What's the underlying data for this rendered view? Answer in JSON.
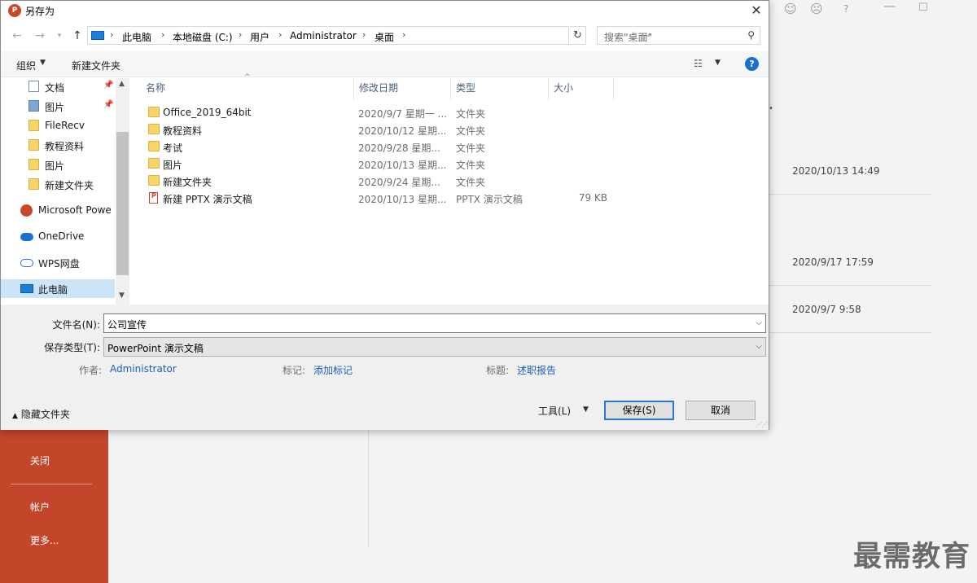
{
  "dialog": {
    "title": "另存为",
    "close": "✕"
  },
  "address": {
    "crumbs": [
      "此电脑",
      "本地磁盘 (C:)",
      "用户",
      "Administrator",
      "桌面"
    ],
    "search_placeholder": "搜索\"桌面\""
  },
  "toolbar": {
    "organize": "组织",
    "new_folder": "新建文件夹"
  },
  "nav": {
    "items": [
      {
        "label": "文档",
        "icon": "document-icon",
        "pinned": true
      },
      {
        "label": "图片",
        "icon": "picture-icon",
        "pinned": true
      },
      {
        "label": "FileRecv",
        "icon": "folder-icon"
      },
      {
        "label": "教程资料",
        "icon": "folder-icon"
      },
      {
        "label": "图片",
        "icon": "folder-icon"
      },
      {
        "label": "新建文件夹",
        "icon": "folder-icon"
      },
      {
        "label": "Microsoft Powe",
        "icon": "powerpoint-icon"
      },
      {
        "label": "OneDrive",
        "icon": "onedrive-cloud-icon"
      },
      {
        "label": "WPS网盘",
        "icon": "wps-cloud-icon"
      },
      {
        "label": "此电脑",
        "icon": "this-pc-icon",
        "selected": true
      }
    ]
  },
  "columns": {
    "name": "名称",
    "modified": "修改日期",
    "type": "类型",
    "size": "大小"
  },
  "files": [
    {
      "name": "Office_2019_64bit",
      "date": "2020/9/7 星期一 ...",
      "type": "文件夹",
      "size": "",
      "icon": "folder-icon"
    },
    {
      "name": "教程资料",
      "date": "2020/10/12 星期...",
      "type": "文件夹",
      "size": "",
      "icon": "folder-icon"
    },
    {
      "name": "考试",
      "date": "2020/9/28 星期...",
      "type": "文件夹",
      "size": "",
      "icon": "folder-icon"
    },
    {
      "name": "图片",
      "date": "2020/10/13 星期...",
      "type": "文件夹",
      "size": "",
      "icon": "folder-icon"
    },
    {
      "name": "新建文件夹",
      "date": "2020/9/24 星期...",
      "type": "文件夹",
      "size": "",
      "icon": "folder-icon"
    },
    {
      "name": "新建 PPTX 演示文稿",
      "date": "2020/10/13 星期...",
      "type": "PPTX 演示文稿",
      "size": "79 KB",
      "icon": "pptx-file-icon"
    }
  ],
  "form": {
    "filename_label": "文件名(N):",
    "filename_value": "公司宣传",
    "filetype_label": "保存类型(T):",
    "filetype_value": "PowerPoint 演示文稿",
    "author_label": "作者:",
    "author_value": "Administrator",
    "tags_label": "标记:",
    "tags_value": "添加标记",
    "title_label": "标题:",
    "title_value": "述职报告"
  },
  "footer": {
    "hide_folders": "隐藏文件夹",
    "tools": "工具(L)",
    "save": "保存(S)",
    "cancel": "取消"
  },
  "background": {
    "recent_dates": [
      "2020/10/13 14:49",
      "2020/9/17 17:59",
      "2020/9/7 9:58"
    ],
    "backstage_items": [
      "关闭",
      "帐户",
      "更多..."
    ],
    "watermark": "最需教育",
    "accent": "#c3462b"
  }
}
